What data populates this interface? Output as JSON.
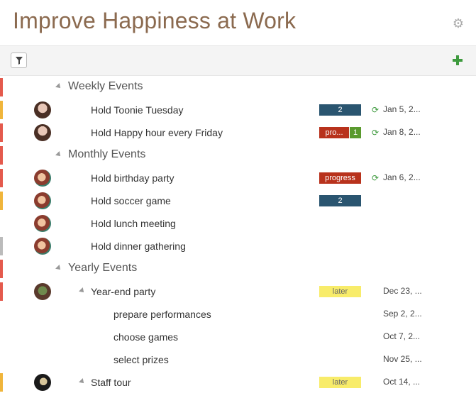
{
  "header": {
    "title": "Improve Happiness at Work",
    "settings_icon": "gear-icon"
  },
  "toolbar": {
    "filter_icon": "filter-icon",
    "add_icon": "plus-icon"
  },
  "colors": {
    "red": "#e45a4d",
    "yellow": "#f0b53b",
    "gray": "#bbbbbb"
  },
  "groups": {
    "weekly": {
      "label": "Weekly Events"
    },
    "monthly": {
      "label": "Monthly Events"
    },
    "yearly": {
      "label": "Yearly Events"
    }
  },
  "tasks": {
    "toonie": {
      "label": "Hold Toonie Tuesday",
      "badge": "2",
      "date": "Jan 5, 2..."
    },
    "happy": {
      "label": "Hold Happy hour every Friday",
      "badge1": "pro...",
      "badge2": "1",
      "date": "Jan 8, 2..."
    },
    "birthday": {
      "label": "Hold birthday party",
      "badge": "progress",
      "date": "Jan 6, 2..."
    },
    "soccer": {
      "label": "Hold soccer game",
      "badge": "2"
    },
    "lunch": {
      "label": "Hold lunch meeting"
    },
    "dinner": {
      "label": "Hold dinner gathering"
    },
    "yearend": {
      "label": "Year-end party",
      "badge": "later",
      "date": "Dec 23, ..."
    },
    "perform": {
      "label": "prepare performances",
      "date": "Sep 2, 2..."
    },
    "games": {
      "label": "choose games",
      "date": "Oct 7, 2..."
    },
    "prizes": {
      "label": "select prizes",
      "date": "Nov 25, ..."
    },
    "stafftour": {
      "label": "Staff tour",
      "badge": "later",
      "date": "Oct 14, ..."
    }
  }
}
